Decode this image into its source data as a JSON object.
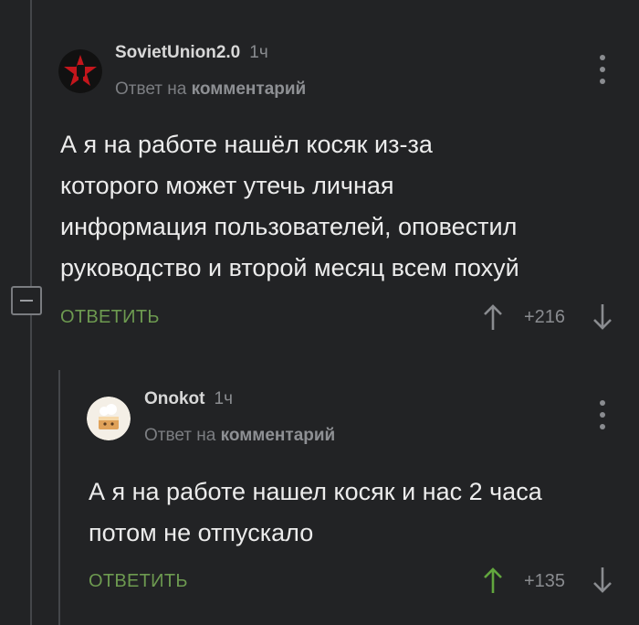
{
  "comments": [
    {
      "author": "SovietUnion2.0",
      "time": "1ч",
      "reply_prefix": "Ответ на",
      "reply_target": "комментарий",
      "text": "А я на работе нашёл косяк из-за\nкоторого может утечь личная\nинформация пользователей, оповестил\nруководство и второй месяц всем похуй",
      "reply_label": "ОТВЕТИТЬ",
      "rating": "+216",
      "upvoted": false
    },
    {
      "author": "Onokot",
      "time": "1ч",
      "reply_prefix": "Ответ на",
      "reply_target": "комментарий",
      "text": "А я на работе нашел косяк и нас 2 часа\nпотом не отпускало",
      "reply_label": "ОТВЕТИТЬ",
      "rating": "+135",
      "upvoted": true
    }
  ],
  "colors": {
    "background": "#222325",
    "reply_link": "#6d9a50",
    "upvote_active": "#62a63e",
    "muted": "#8a8c90"
  },
  "icons": [
    "avatar-red-star-fist",
    "avatar-cat-cake",
    "more-vertical-icon",
    "arrow-up-icon",
    "arrow-down-icon",
    "collapse-minus-icon"
  ]
}
